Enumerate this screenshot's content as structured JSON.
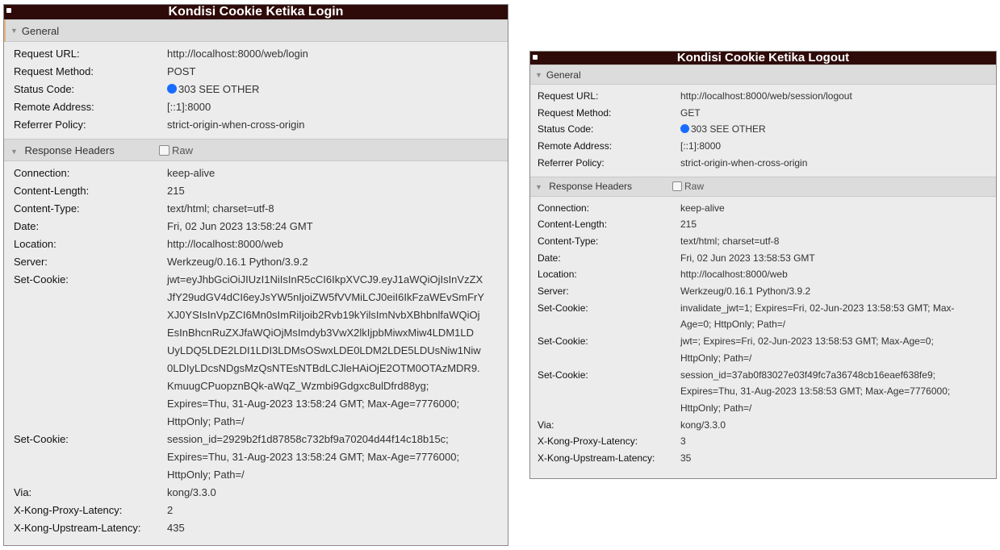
{
  "login": {
    "title": "Kondisi Cookie Ketika Login",
    "general_label": "General",
    "general": [
      {
        "k": "Request URL:",
        "v": "http://localhost:8000/web/login"
      },
      {
        "k": "Request Method:",
        "v": "POST"
      },
      {
        "k": "Status Code:",
        "v": "303 SEE OTHER",
        "status": true
      },
      {
        "k": "Remote Address:",
        "v": "[::1]:8000"
      },
      {
        "k": "Referrer Policy:",
        "v": "strict-origin-when-cross-origin"
      }
    ],
    "response_label": "Response Headers",
    "raw_label": "Raw",
    "headers": [
      {
        "k": "Connection:",
        "v": [
          "keep-alive"
        ]
      },
      {
        "k": "Content-Length:",
        "v": [
          "215"
        ]
      },
      {
        "k": "Content-Type:",
        "v": [
          "text/html; charset=utf-8"
        ]
      },
      {
        "k": "Date:",
        "v": [
          "Fri, 02 Jun 2023 13:58:24 GMT"
        ]
      },
      {
        "k": "Location:",
        "v": [
          "http://localhost:8000/web"
        ]
      },
      {
        "k": "Server:",
        "v": [
          "Werkzeug/0.16.1 Python/3.9.2"
        ]
      },
      {
        "k": "Set-Cookie:",
        "v": [
          "jwt=eyJhbGciOiJIUzI1NiIsInR5cCI6IkpXVCJ9.eyJ1aWQiOjIsInVzZX",
          "JfY29udGV4dCI6eyJsYW5nIjoiZW5fVVMiLCJ0eiI6IkFzaWEvSmFrY",
          "XJ0YSIsInVpZCI6Mn0sImRiIjoib2Rvb19kYilsImNvbXBhbnlfaWQiOj",
          "EsInBhcnRuZXJfaWQiOjMsImdyb3VwX2lkIjpbMiwxMiw4LDM1LD",
          "UyLDQ5LDE2LDI1LDI3LDMsOSwxLDE0LDM2LDE5LDUsNiw1Niw",
          "0LDIyLDcsNDgsMzQsNTEsNTBdLCJleHAiOjE2OTM0OTAzMDR9.",
          "KmuugCPuopznBQk-aWqZ_Wzmbi9Gdgxc8ulDfrd88yg;",
          "Expires=Thu, 31-Aug-2023 13:58:24 GMT; Max-Age=7776000;",
          "HttpOnly; Path=/"
        ]
      },
      {
        "k": "Set-Cookie:",
        "v": [
          "session_id=2929b2f1d87858c732bf9a70204d44f14c18b15c;",
          "Expires=Thu, 31-Aug-2023 13:58:24 GMT; Max-Age=7776000;",
          "HttpOnly; Path=/"
        ]
      },
      {
        "k": "Via:",
        "v": [
          "kong/3.3.0"
        ]
      },
      {
        "k": "X-Kong-Proxy-Latency:",
        "v": [
          "2"
        ]
      },
      {
        "k": "X-Kong-Upstream-Latency:",
        "v": [
          "435"
        ]
      }
    ]
  },
  "logout": {
    "title": "Kondisi Cookie Ketika Logout",
    "general_label": "General",
    "general": [
      {
        "k": "Request URL:",
        "v": "http://localhost:8000/web/session/logout"
      },
      {
        "k": "Request Method:",
        "v": "GET"
      },
      {
        "k": "Status Code:",
        "v": "303 SEE OTHER",
        "status": true
      },
      {
        "k": "Remote Address:",
        "v": "[::1]:8000"
      },
      {
        "k": "Referrer Policy:",
        "v": "strict-origin-when-cross-origin"
      }
    ],
    "response_label": "Response Headers",
    "raw_label": "Raw",
    "headers": [
      {
        "k": "Connection:",
        "v": [
          "keep-alive"
        ]
      },
      {
        "k": "Content-Length:",
        "v": [
          "215"
        ]
      },
      {
        "k": "Content-Type:",
        "v": [
          "text/html; charset=utf-8"
        ]
      },
      {
        "k": "Date:",
        "v": [
          "Fri, 02 Jun 2023 13:58:53 GMT"
        ]
      },
      {
        "k": "Location:",
        "v": [
          "http://localhost:8000/web"
        ]
      },
      {
        "k": "Server:",
        "v": [
          "Werkzeug/0.16.1 Python/3.9.2"
        ]
      },
      {
        "k": "Set-Cookie:",
        "v": [
          "invalidate_jwt=1; Expires=Fri, 02-Jun-2023 13:58:53 GMT; Max-",
          "Age=0; HttpOnly; Path=/"
        ]
      },
      {
        "k": "Set-Cookie:",
        "v": [
          "jwt=; Expires=Fri, 02-Jun-2023 13:58:53 GMT; Max-Age=0;",
          "HttpOnly; Path=/"
        ]
      },
      {
        "k": "Set-Cookie:",
        "v": [
          "session_id=37ab0f83027e03f49fc7a36748cb16eaef638fe9;",
          "Expires=Thu, 31-Aug-2023 13:58:53 GMT; Max-Age=7776000;",
          "HttpOnly; Path=/"
        ]
      },
      {
        "k": "Via:",
        "v": [
          "kong/3.3.0"
        ]
      },
      {
        "k": "X-Kong-Proxy-Latency:",
        "v": [
          "3"
        ]
      },
      {
        "k": "X-Kong-Upstream-Latency:",
        "v": [
          "35"
        ]
      }
    ]
  },
  "colors": {
    "title_bar": "#2e0a08",
    "status_dot": "#1a6cff",
    "panel_bg": "#ececec"
  },
  "icons": [
    "collapse-triangle-icon",
    "status-dot-icon",
    "raw-checkbox"
  ]
}
